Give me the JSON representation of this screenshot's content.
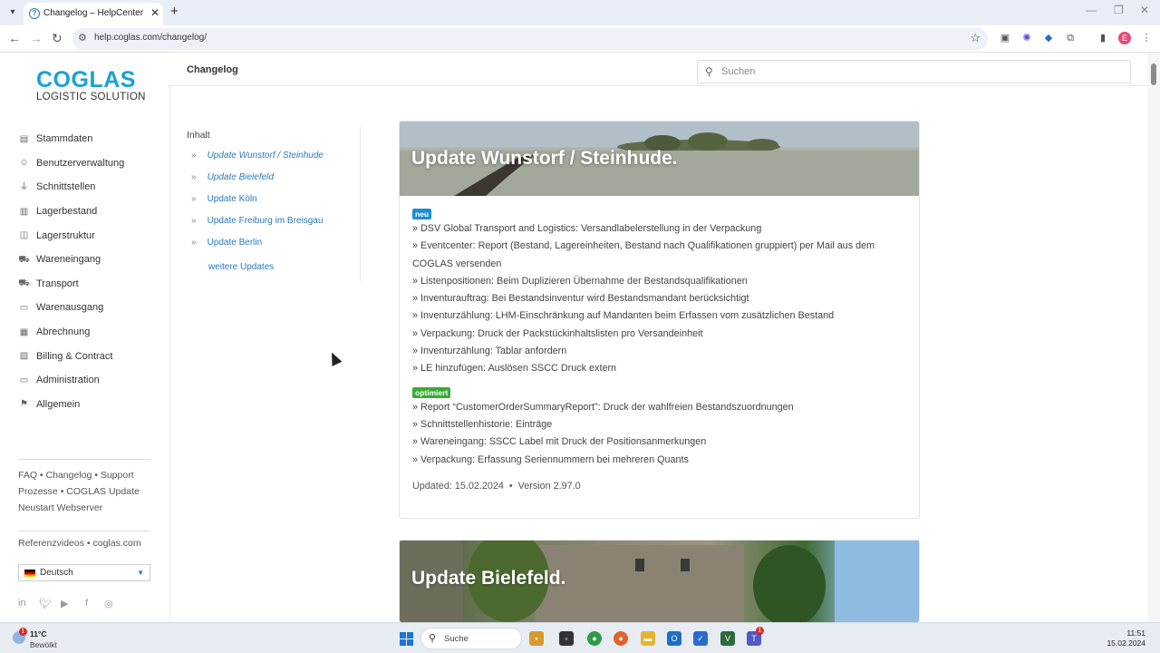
{
  "browser": {
    "tab_title": "Changelog – HelpCenter",
    "url": "help.coglas.com/changelog/"
  },
  "sidebar": {
    "logo_main": "COGLAS",
    "logo_sub": "LOGISTIC SOLUTION",
    "items": [
      {
        "label": "Stammdaten",
        "icon": "document-icon"
      },
      {
        "label": "Benutzerverwaltung",
        "icon": "users-icon"
      },
      {
        "label": "Schnittstellen",
        "icon": "plug-icon"
      },
      {
        "label": "Lagerbestand",
        "icon": "chart-icon"
      },
      {
        "label": "Lagerstruktur",
        "icon": "structure-icon"
      },
      {
        "label": "Wareneingang",
        "icon": "truck-in-icon"
      },
      {
        "label": "Transport",
        "icon": "truck-icon"
      },
      {
        "label": "Warenausgang",
        "icon": "box-out-icon"
      },
      {
        "label": "Abrechnung",
        "icon": "invoice-icon"
      },
      {
        "label": "Billing & Contract",
        "icon": "contract-icon"
      },
      {
        "label": "Administration",
        "icon": "admin-icon"
      },
      {
        "label": "Allgemein",
        "icon": "bookmark-icon"
      }
    ],
    "footer": {
      "faq": "FAQ",
      "changelog": "Changelog",
      "support": "Support",
      "prozesse": "Prozesse",
      "coglas_update": "COGLAS Update",
      "neustart": "Neustart Webserver",
      "referenzvideos": "Referenzvideos",
      "coglas_com": "coglas.com"
    },
    "language": "Deutsch"
  },
  "header": {
    "title": "Changelog",
    "search_placeholder": "Suchen"
  },
  "toc": {
    "title": "Inhalt",
    "items": [
      "Update Wunstorf / Steinhude",
      "Update Bielefeld",
      "Update Köln",
      "Update Freiburg im Breisgau",
      "Update Berlin"
    ],
    "more": "weitere Updates"
  },
  "updates": [
    {
      "title": "Update Wunstorf / Steinhude.",
      "badge_new": "neu",
      "new_entries": [
        "» DSV Global Transport and Logistics: Versandlabelerstellung in der Verpackung",
        "» Eventcenter: Report (Bestand, Lagereinheiten, Bestand nach Qualifikationen gruppiert) per Mail aus dem COGLAS versenden",
        "» Listenpositionen: Beim Duplizieren Übernahme der Bestandsqualifikationen",
        "» Inventurauftrag: Bei Bestandsinventur wird Bestandsmandant berücksichtigt",
        "» Inventurzählung: LHM-Einschränkung auf Mandanten beim Erfassen vom zusätzlichen Bestand",
        "» Verpackung: Druck der Packstückinhaltslisten pro Versandeinheit",
        "» Inventurzählung: Tablar anfordern",
        "» LE hinzufügen: Auslösen SSCC Druck extern"
      ],
      "badge_optimized": "optimiert",
      "optimized_entries": [
        "» Report “CustomerOrderSummaryReport”: Druck der wahlfreien Bestandszuordnungen",
        "» Schnittstellenhistorie: Einträge",
        "» Wareneingang: SSCC Label mit Druck der Positionsanmerkungen",
        "» Verpackung: Erfassung Seriennummern bei mehreren Quants"
      ],
      "updated": "Updated: 15.02.2024",
      "version": "Version 2.97.0"
    },
    {
      "title": "Update Bielefeld."
    }
  ],
  "taskbar": {
    "temperature": "11°C",
    "weather": "Bewölkt",
    "weather_badge": "1",
    "search_label": "Suche",
    "time": "11:51",
    "date": "15.02.2024",
    "teams_badge": "1"
  }
}
